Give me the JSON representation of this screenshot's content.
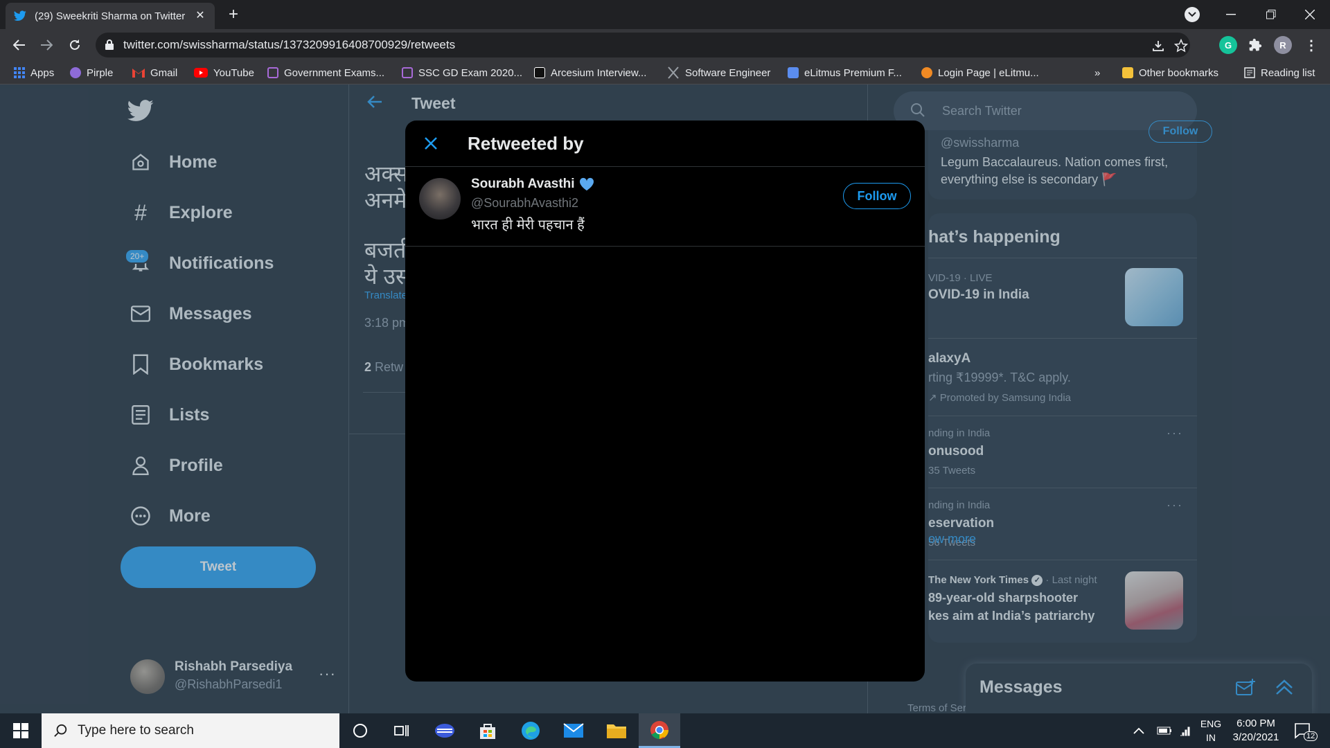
{
  "browser": {
    "tab_title": "(29) Sweekriti Sharma on Twitter:",
    "url": "twitter.com/swissharma/status/1373209916408700929/retweets",
    "profile_initial": "R",
    "grammarly_initial": "G",
    "bookmarks": [
      {
        "label": "Apps",
        "color": "#4285f4"
      },
      {
        "label": "Pirple",
        "color": "#8e6bd8"
      },
      {
        "label": "Gmail",
        "color": "#ea4335"
      },
      {
        "label": "YouTube",
        "color": "#ff0000"
      },
      {
        "label": "Government Exams...",
        "color": "#a86ad8"
      },
      {
        "label": "SSC GD Exam 2020...",
        "color": "#a86ad8"
      },
      {
        "label": "Arcesium Interview...",
        "color": "#111111"
      },
      {
        "label": "Software Engineer",
        "color": "#9aa0a6"
      },
      {
        "label": "eLitmus Premium F...",
        "color": "#5b8def"
      },
      {
        "label": "Login Page | eLitmu...",
        "color": "#f08a24"
      }
    ],
    "bookmarks_overflow": "»",
    "other_bookmarks": "Other bookmarks",
    "reading_list": "Reading list"
  },
  "sidebar": {
    "items": [
      {
        "label": "Home",
        "icon": "home-icon"
      },
      {
        "label": "Explore",
        "icon": "hashtag-icon"
      },
      {
        "label": "Notifications",
        "icon": "bell-icon",
        "badge": "20+"
      },
      {
        "label": "Messages",
        "icon": "envelope-icon"
      },
      {
        "label": "Bookmarks",
        "icon": "bookmark-icon"
      },
      {
        "label": "Lists",
        "icon": "list-icon"
      },
      {
        "label": "Profile",
        "icon": "person-icon"
      },
      {
        "label": "More",
        "icon": "more-circle-icon"
      }
    ],
    "tweet_button": "Tweet",
    "account": {
      "name": "Rishabh Parsediya",
      "handle": "@RishabhParsedi1",
      "more": "···"
    }
  },
  "main": {
    "title": "Tweet",
    "tweet_line1": "अक्स",
    "tweet_line2": "अनमे",
    "tweet_line3": "बजती",
    "tweet_line4": "ये उस्",
    "translate": "Translate",
    "time": "3:18 pm",
    "retweet_count": "2",
    "retweet_label": "Retw"
  },
  "right": {
    "search_placeholder": "Search Twitter",
    "profile_card": {
      "handle": "@swissharma",
      "follow": "Follow",
      "bio": "Legum Baccalaureus. Nation comes first, everything else is secondary 🚩"
    },
    "happening_title": "hat’s happening",
    "trends": [
      {
        "meta": "VID-19 · LIVE",
        "name": "OVID-19 in India",
        "sub": ""
      },
      {
        "meta": "",
        "name": "alaxyA",
        "sub": "rting ₹19999*. T&C apply.",
        "meta2": "Promoted by Samsung India"
      },
      {
        "meta": "nding in India",
        "name": "onusood",
        "sub": "35 Tweets"
      },
      {
        "meta": "nding in India",
        "name": "eservation",
        "sub": "56 Tweets"
      },
      {
        "meta": "The New York Times",
        "meta_time": "· Last night",
        "name": "89-year-old sharpshooter",
        "sub": "kes aim at India’s patriarchy"
      }
    ],
    "show_more": "ow more",
    "terms": "Terms of Ser"
  },
  "messages_drawer": {
    "title": "Messages"
  },
  "modal": {
    "title": "Retweeted by",
    "user": {
      "name": "Sourabh Avasthi",
      "handle": "@SourabhAvasthi2",
      "bio": "भारत ही मेरी पहचान हैं",
      "follow_label": "Follow"
    }
  },
  "taskbar": {
    "search_placeholder": "Type here to search",
    "lang_line1": "ENG",
    "lang_line2": "IN",
    "time": "6:00 PM",
    "date": "3/20/2021",
    "notifications": "12"
  },
  "colors": {
    "accent": "#1d9bf0",
    "background": "#15202b",
    "modal_bg": "#000000"
  }
}
